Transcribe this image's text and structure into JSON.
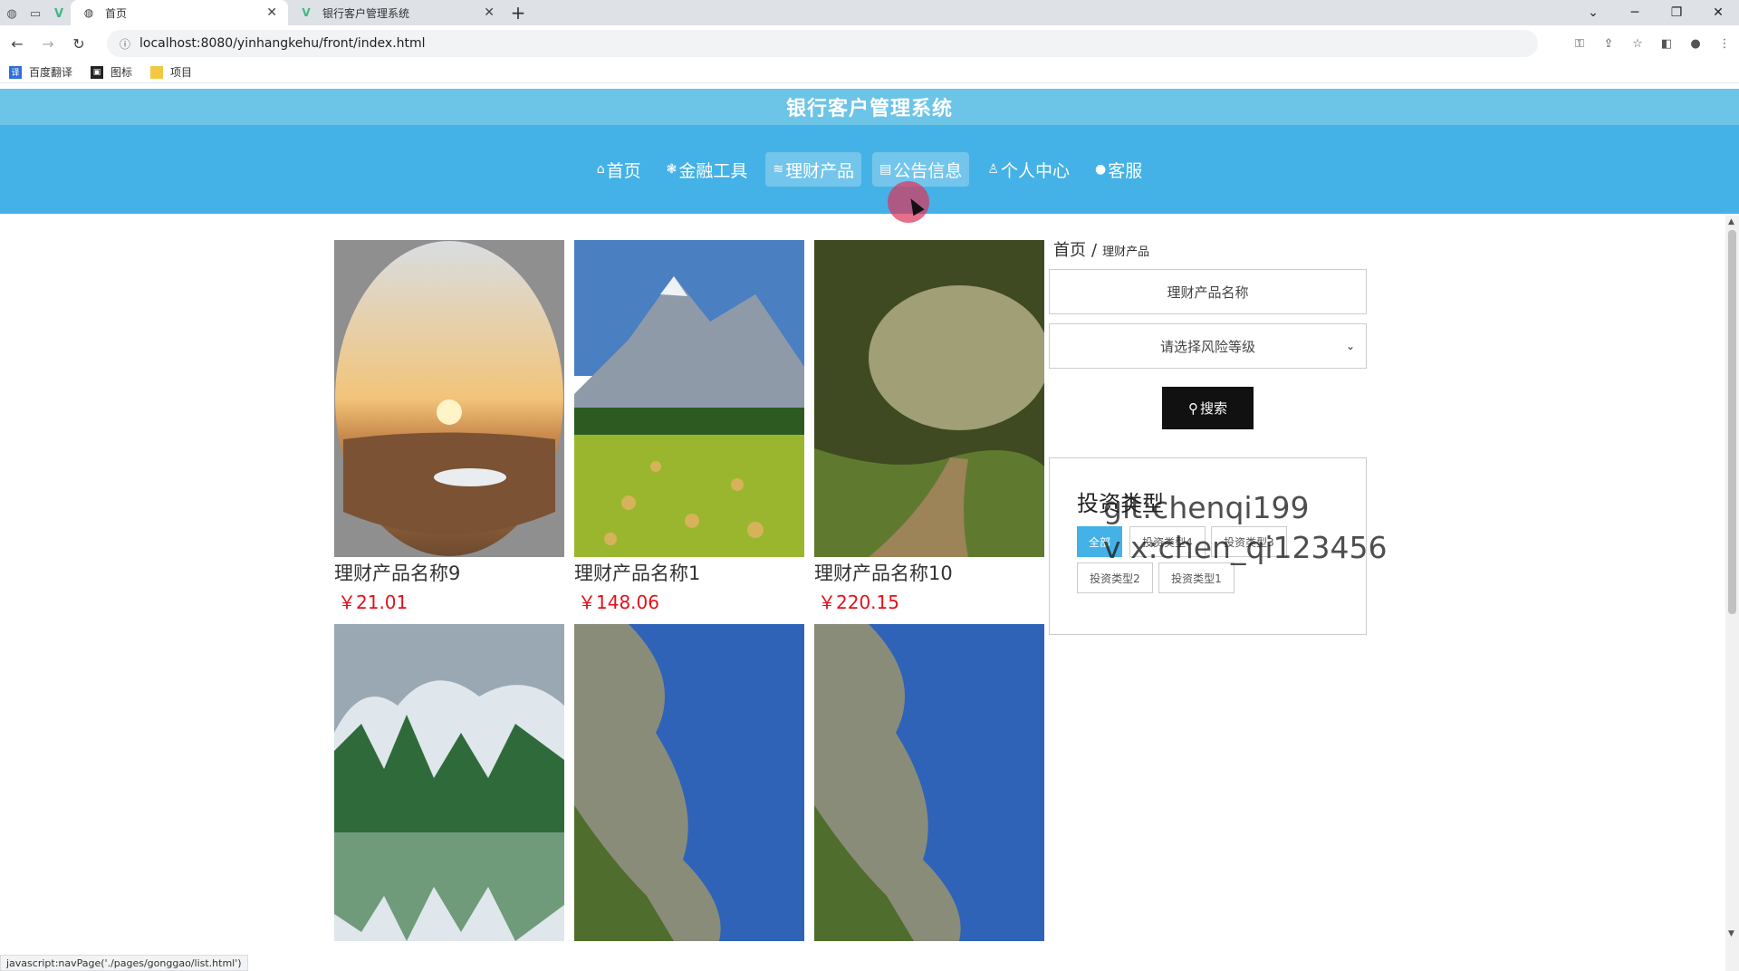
{
  "browser": {
    "tabs": [
      {
        "title": "首页",
        "active": true
      },
      {
        "title": "银行客户管理系统",
        "active": false
      }
    ],
    "url": "localhost:8080/yinhangkehu/front/index.html",
    "bookmarks": [
      "百度翻译",
      "图标",
      "项目"
    ],
    "status_text": "javascript:navPage('./pages/gonggao/list.html')"
  },
  "site": {
    "title": "银行客户管理系统",
    "nav": [
      {
        "label": "首页",
        "icon": "home-icon",
        "glyph": "⌂",
        "active": false
      },
      {
        "label": "金融工具",
        "icon": "asterisk-icon",
        "glyph": "❃",
        "active": false
      },
      {
        "label": "理财产品",
        "icon": "layers-icon",
        "glyph": "≋",
        "active": true
      },
      {
        "label": "公告信息",
        "icon": "news-icon",
        "glyph": "▤",
        "active": true
      },
      {
        "label": "个人中心",
        "icon": "user-icon",
        "glyph": "♙",
        "active": false
      },
      {
        "label": "客服",
        "icon": "chat-icon",
        "glyph": "●",
        "active": false
      }
    ]
  },
  "breadcrumb": {
    "home": "首页",
    "sep": "/",
    "current": "理财产品"
  },
  "search": {
    "name_placeholder": "理财产品名称",
    "risk_placeholder": "请选择风险等级",
    "button": "搜索"
  },
  "filter": {
    "title": "投资类型",
    "tags": [
      "全部",
      "投资类型4",
      "投资类型3",
      "投资类型2",
      "投资类型1"
    ],
    "selected": "全部"
  },
  "watermark": [
    "git:chenqi199",
    "v x:chen_qi123456"
  ],
  "products": [
    {
      "name": "理财产品名称9",
      "price": "￥21.01",
      "image": "desert-sunset"
    },
    {
      "name": "理财产品名称1",
      "price": "￥148.06",
      "image": "mountain-meadow"
    },
    {
      "name": "理财产品名称10",
      "price": "￥220.15",
      "image": "forest-path"
    },
    {
      "name": "",
      "price": "",
      "image": "karst-river"
    },
    {
      "name": "",
      "price": "",
      "image": "coast-aerial"
    },
    {
      "name": "",
      "price": "",
      "image": "coast-aerial"
    }
  ],
  "colors": {
    "header_top": "#6cc4e6",
    "nav_bg": "#44b2e6",
    "price": "#e4111b",
    "accent": "#44b2e6"
  }
}
